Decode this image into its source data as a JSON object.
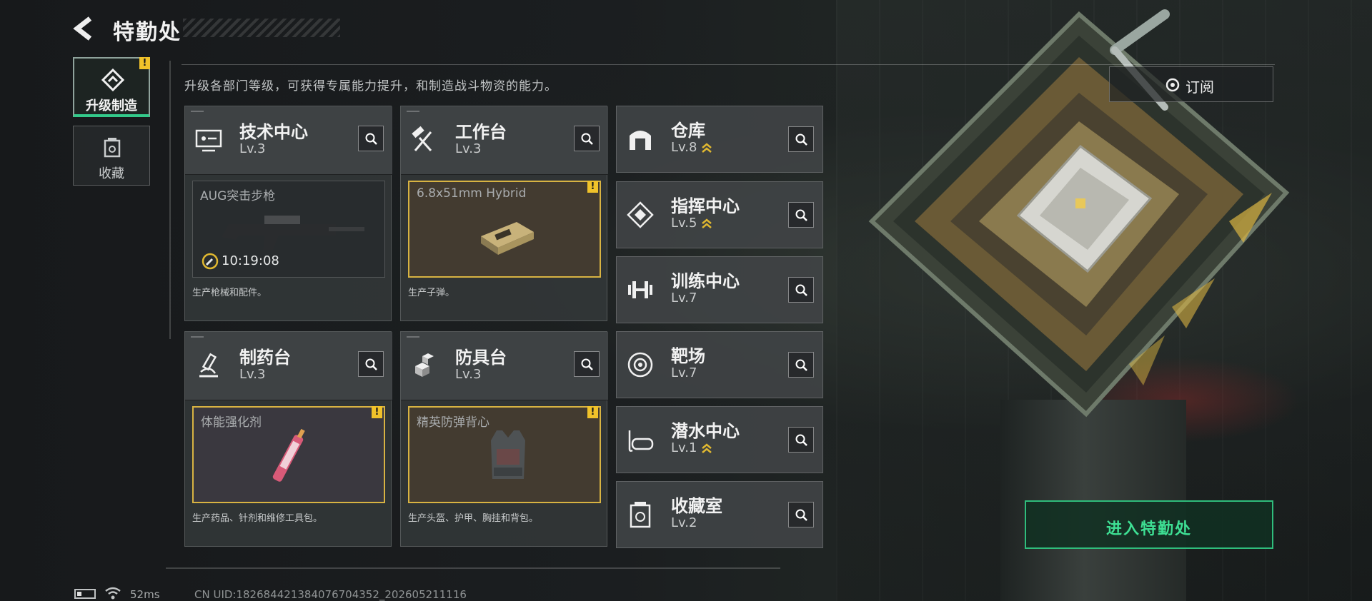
{
  "header": {
    "title": "特勤处",
    "description": "升级各部门等级，可获得专属能力提升，和制造战斗物资的能力。"
  },
  "tabs": [
    {
      "label": "升级制造",
      "active": true,
      "icon": "upgrade-icon",
      "warning": "!"
    },
    {
      "label": "收藏",
      "active": false,
      "icon": "collection-icon"
    }
  ],
  "main_cards": [
    {
      "name": "技术中心",
      "level": "Lv.3",
      "icon": "tech-center-icon",
      "product": "AUG突击步枪",
      "timer": "10:19:08",
      "desc": "生产枪械和配件。"
    },
    {
      "name": "工作台",
      "level": "Lv.3",
      "icon": "workbench-icon",
      "product": "6.8x51mm Hybrid",
      "warning": "!",
      "desc": "生产子弹。"
    },
    {
      "name": "制药台",
      "level": "Lv.3",
      "icon": "pharmacy-icon",
      "product": "体能强化剂",
      "warning": "!",
      "desc": "生产药品、针剂和维修工具包。"
    },
    {
      "name": "防具台",
      "level": "Lv.3",
      "icon": "armor-bench-icon",
      "product": "精英防弹背心",
      "warning": "!",
      "desc": "生产头盔、护甲、胸挂和背包。"
    }
  ],
  "side_cards": [
    {
      "name": "仓库",
      "level": "Lv.8",
      "icon": "warehouse-icon",
      "upgradable": true
    },
    {
      "name": "指挥中心",
      "level": "Lv.5",
      "icon": "command-center-icon",
      "upgradable": true
    },
    {
      "name": "训练中心",
      "level": "Lv.7",
      "icon": "training-center-icon",
      "upgradable": false
    },
    {
      "name": "靶场",
      "level": "Lv.7",
      "icon": "shooting-range-icon",
      "upgradable": false
    },
    {
      "name": "潜水中心",
      "level": "Lv.1",
      "icon": "diving-center-icon",
      "upgradable": true
    },
    {
      "name": "收藏室",
      "level": "Lv.2",
      "icon": "collection-room-icon",
      "upgradable": false
    }
  ],
  "right": {
    "subscribe_label": "订阅",
    "enter_label": "进入特勤处"
  },
  "footer": {
    "ping": "52ms",
    "uid": "CN UID:18268442138407670435​2_202605211116"
  },
  "colors": {
    "accent_green": "#2fbd7c",
    "warning_yellow": "#f0c22a",
    "gold_border": "#d8b342"
  }
}
